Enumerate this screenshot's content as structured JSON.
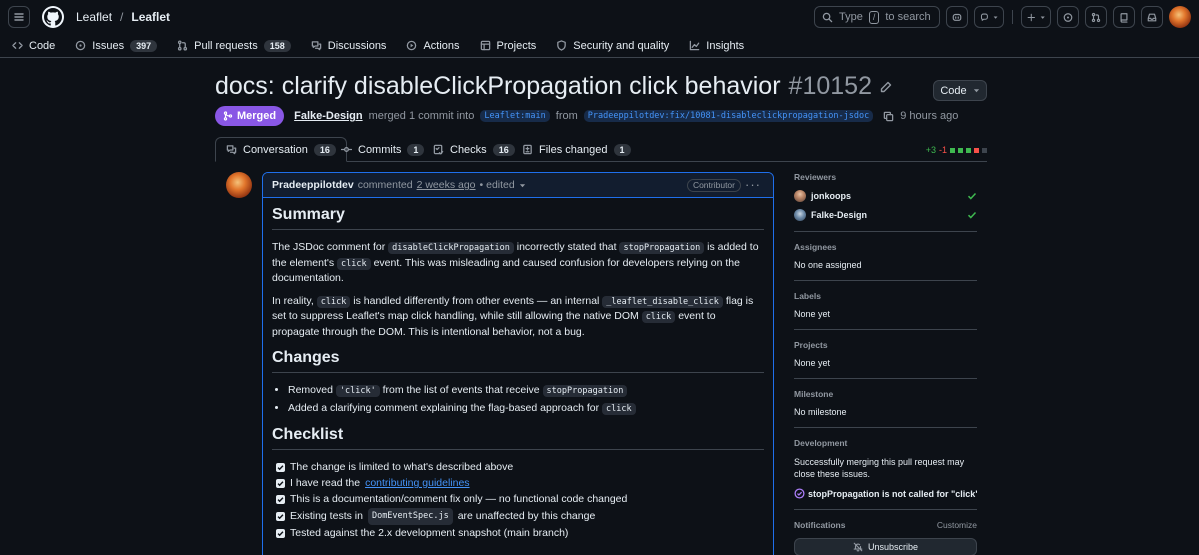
{
  "header": {
    "owner": "Leaflet",
    "separator": "/",
    "repo": "Leaflet",
    "search_prefix": "Type",
    "search_key": "/",
    "search_suffix": "to search"
  },
  "repo_nav": {
    "items": [
      {
        "label": "Code",
        "icon": "code-icon"
      },
      {
        "label": "Issues",
        "icon": "issue-icon",
        "count": "397"
      },
      {
        "label": "Pull requests",
        "icon": "pull-request-icon",
        "count": "158"
      },
      {
        "label": "Discussions",
        "icon": "discussion-icon"
      },
      {
        "label": "Actions",
        "icon": "play-icon"
      },
      {
        "label": "Projects",
        "icon": "table-icon"
      },
      {
        "label": "Security and quality",
        "icon": "shield-icon"
      },
      {
        "label": "Insights",
        "icon": "graph-icon"
      }
    ]
  },
  "pr": {
    "title": "docs: clarify disableClickPropagation click behavior",
    "number": "#10152",
    "code_button": "Code",
    "state": "Merged",
    "merged_by": "Falke-Design",
    "merge_text": "merged 1 commit into",
    "base_branch": "Leaflet:main",
    "from_text": "from",
    "head_branch": "Pradeeppilotdev:fix/10081-disableclickpropagation-jsdoc",
    "time": "9 hours ago"
  },
  "tabs": [
    {
      "label": "Conversation",
      "count": "16"
    },
    {
      "label": "Commits",
      "count": "1"
    },
    {
      "label": "Checks",
      "count": "16"
    },
    {
      "label": "Files changed",
      "count": "1"
    }
  ],
  "diffstat": {
    "additions": "+3",
    "deletions": "-1"
  },
  "comment": {
    "author": "Pradeeppilotdev",
    "action": "commented",
    "when": "2 weeks ago",
    "edited": "• edited",
    "role": "Contributor",
    "summary_heading": "Summary",
    "p1": {
      "a": "The JSDoc comment for",
      "c1": "disableClickPropagation",
      "b": "incorrectly stated that",
      "c2": "stopPropagation",
      "c": "is added to the element's",
      "c3": "click",
      "d": "event. This was misleading and caused confusion for developers relying on the documentation."
    },
    "p2": {
      "a": "In reality,",
      "c1": "click",
      "b": "is handled differently from other events — an internal",
      "c2": "_leaflet_disable_click",
      "c": "flag is set to suppress Leaflet's map click handling, while still allowing the native DOM",
      "c3": "click",
      "d": "event to propagate through the DOM. This is intentional behavior, not a bug."
    },
    "changes_heading": "Changes",
    "change1": {
      "a": "Removed",
      "c1": "'click'",
      "b": "from the list of events that receive",
      "c2": "stopPropagation"
    },
    "change2": {
      "a": "Added a clarifying comment explaining the flag-based approach for",
      "c1": "click"
    },
    "checklist_heading": "Checklist",
    "check1": "The change is limited to what's described above",
    "check2_a": "I have read the",
    "check2_link": "contributing guidelines",
    "check3": "This is a documentation/comment fix only — no functional code changed",
    "check4_a": "Existing tests in",
    "check4_code": "DomEventSpec.js",
    "check4_b": "are unaffected by this change",
    "check5": "Tested against the 2.x development snapshot (main branch)"
  },
  "sidebar": {
    "reviewers_heading": "Reviewers",
    "reviewers": [
      "jonkoops",
      "Falke-Design"
    ],
    "assignees_heading": "Assignees",
    "assignees": "No one assigned",
    "labels_heading": "Labels",
    "labels": "None yet",
    "projects_heading": "Projects",
    "projects": "None yet",
    "milestone_heading": "Milestone",
    "milestone": "No milestone",
    "development_heading": "Development",
    "development_text": "Successfully merging this pull request may close these issues.",
    "linked_issue": "stopPropagation is not called for \"click\" in di...",
    "notifications_heading": "Notifications",
    "customize": "Customize",
    "unsubscribe": "Unsubscribe"
  },
  "colors": {
    "background": "#0d1117",
    "merged": "#8957e5",
    "link": "#4493f8",
    "border": "#3d444d",
    "add": "#3fb950",
    "delete": "#f85149"
  }
}
